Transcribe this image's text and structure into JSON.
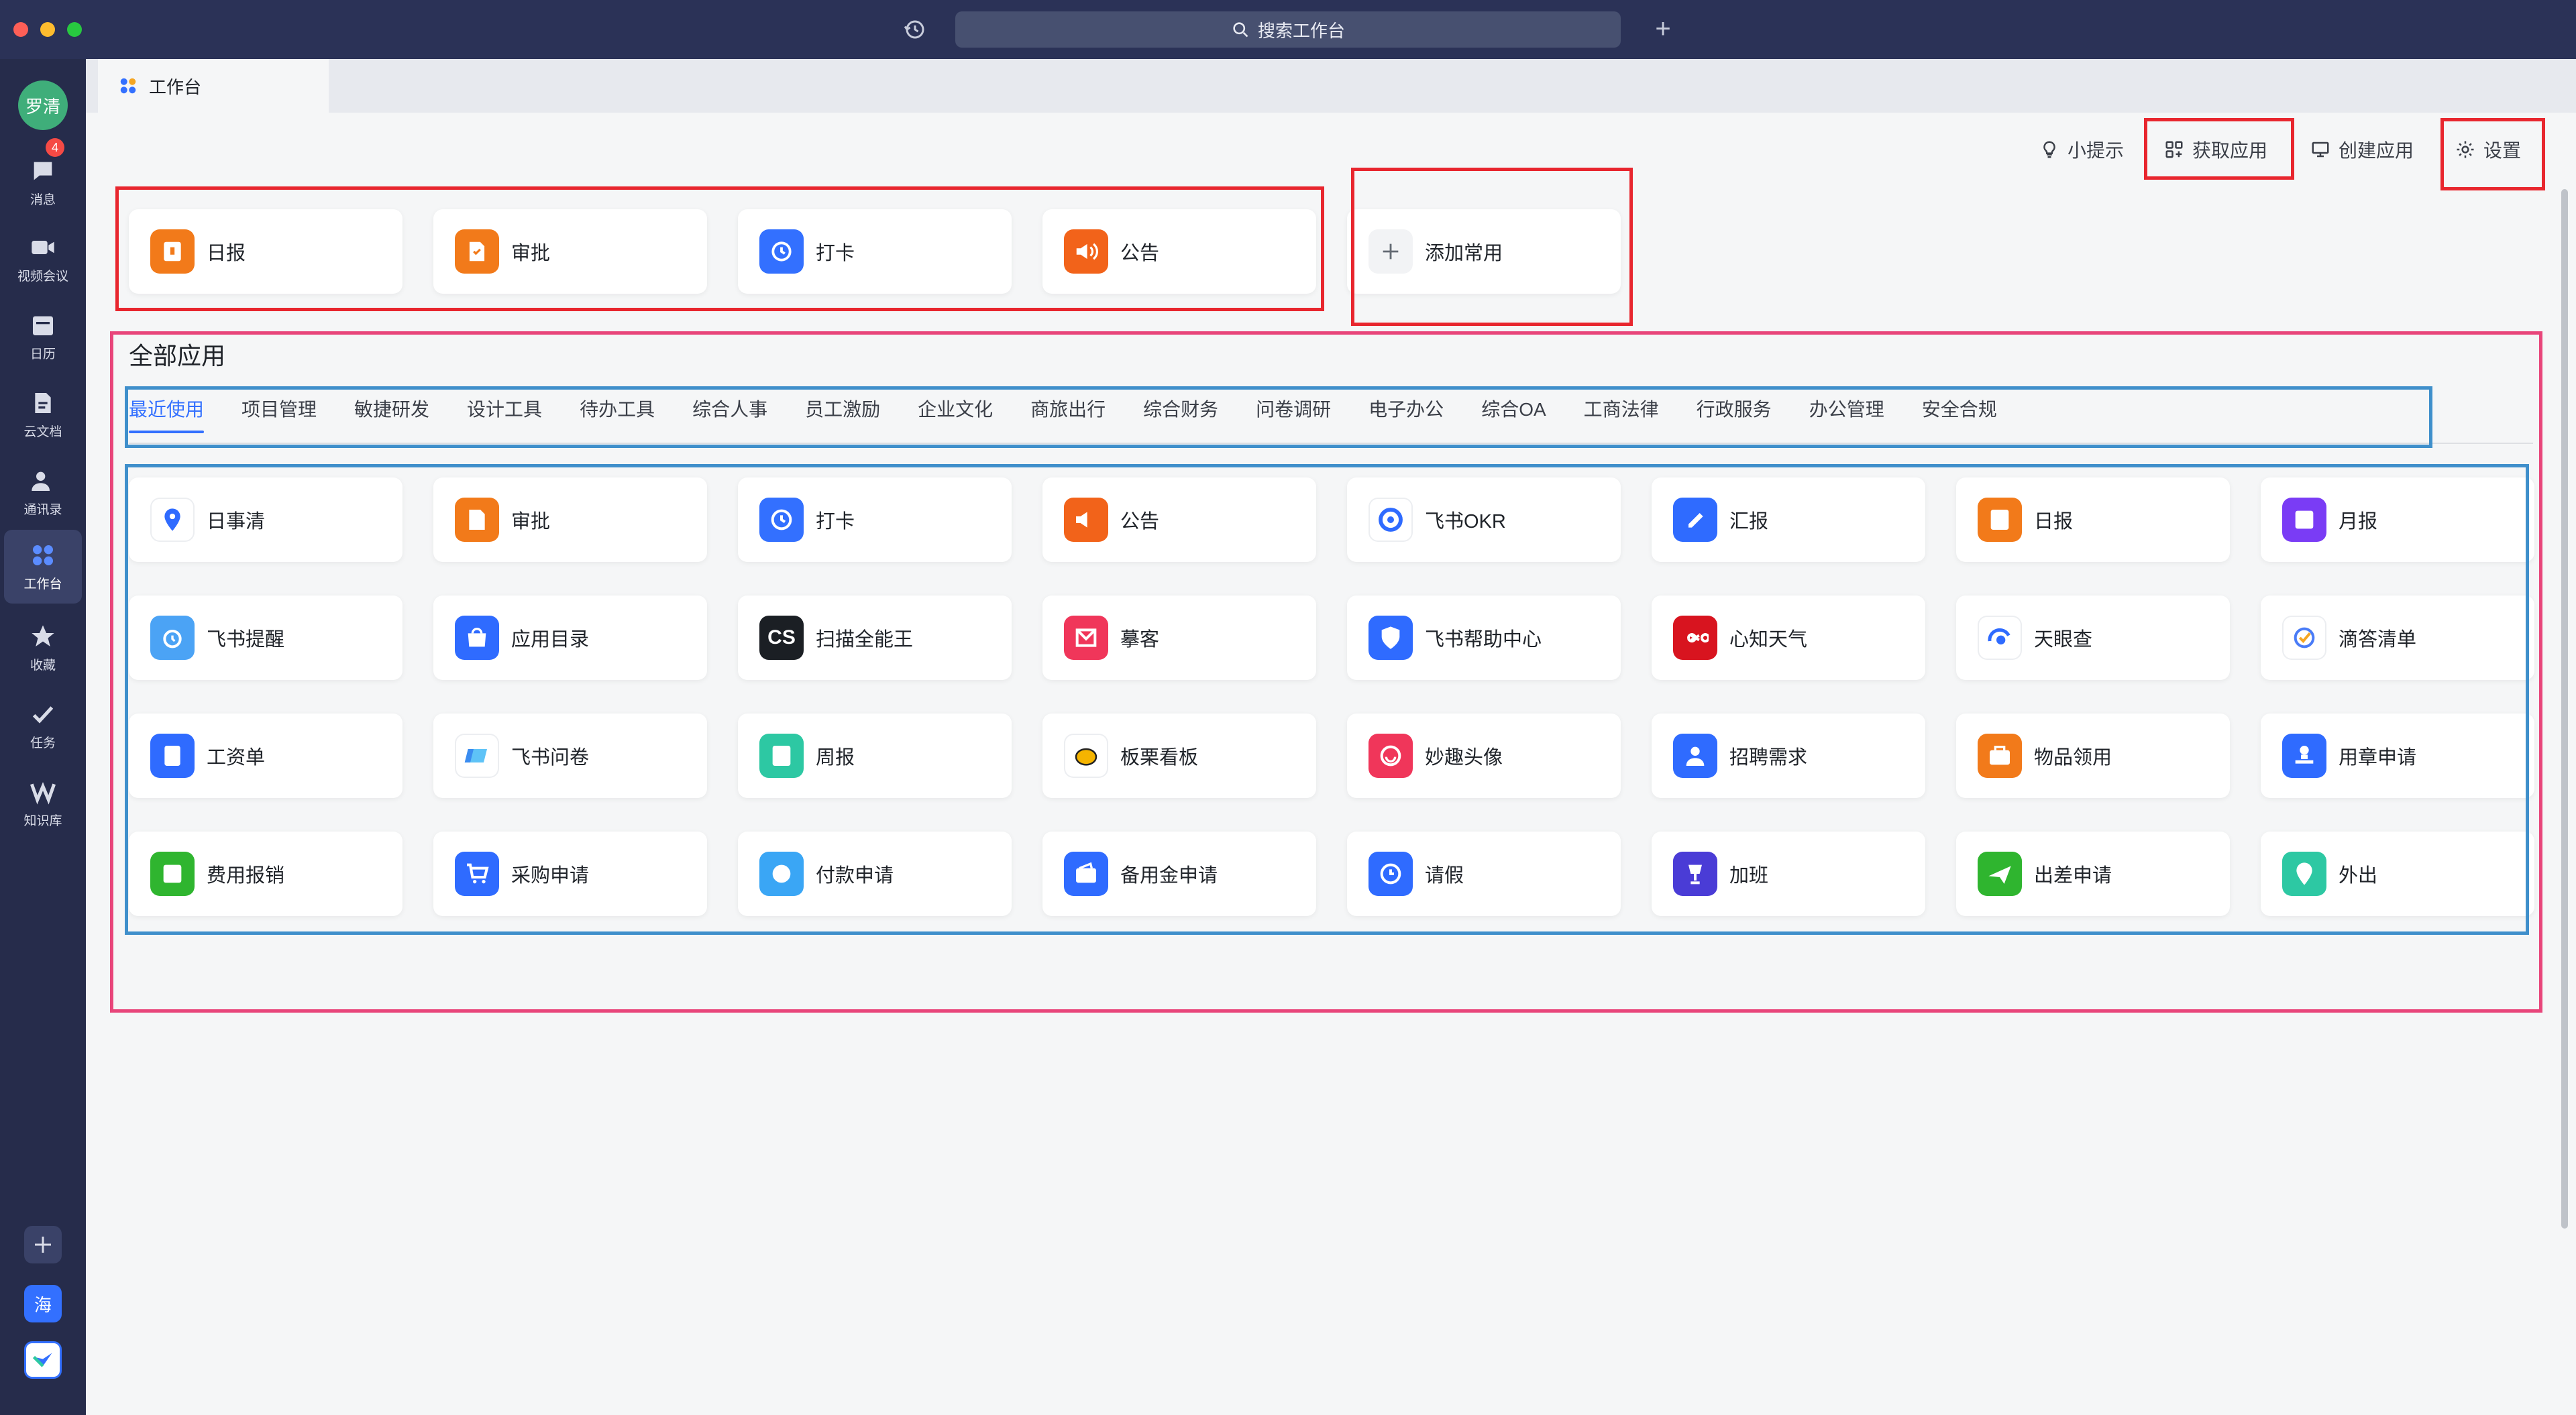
{
  "titlebar": {
    "search_placeholder": "搜索工作台",
    "colors": {
      "bar": "#2b3257",
      "search": "#475070"
    }
  },
  "sidebar": {
    "avatar_text": "罗清",
    "badge_count": "4",
    "items": [
      {
        "label": "消息",
        "icon": "message-icon"
      },
      {
        "label": "视频会议",
        "icon": "video-icon"
      },
      {
        "label": "日历",
        "icon": "calendar-icon"
      },
      {
        "label": "云文档",
        "icon": "doc-icon"
      },
      {
        "label": "通讯录",
        "icon": "contacts-icon"
      },
      {
        "label": "工作台",
        "icon": "workplace-icon",
        "active": true
      },
      {
        "label": "收藏",
        "icon": "star-icon"
      },
      {
        "label": "任务",
        "icon": "task-icon"
      },
      {
        "label": "知识库",
        "icon": "wiki-icon"
      }
    ],
    "bottom_app_label": "海"
  },
  "tabbar": {
    "tab_label": "工作台"
  },
  "actions": {
    "tips": "小提示",
    "get_apps": "获取应用",
    "create_app": "创建应用",
    "settings": "设置"
  },
  "favorites": {
    "apps": [
      {
        "label": "日报",
        "icon": "daily-report-icon",
        "color": "#f27a1a"
      },
      {
        "label": "审批",
        "icon": "approval-icon",
        "color": "#f27a1a"
      },
      {
        "label": "打卡",
        "icon": "clock-in-icon",
        "color": "#3370ff"
      },
      {
        "label": "公告",
        "icon": "announcement-icon",
        "color": "#f2631a"
      }
    ],
    "add_label": "添加常用"
  },
  "all_apps": {
    "title": "全部应用",
    "categories": [
      "最近使用",
      "项目管理",
      "敏捷研发",
      "设计工具",
      "待办工具",
      "综合人事",
      "员工激励",
      "企业文化",
      "商旅出行",
      "综合财务",
      "问卷调研",
      "电子办公",
      "综合OA",
      "工商法律",
      "行政服务",
      "办公管理",
      "安全合规"
    ],
    "active_category": "最近使用",
    "rows": [
      [
        {
          "label": "日事清",
          "icon": "location-pin-icon",
          "color": "#ffffff",
          "fg": "#2f6bff"
        },
        {
          "label": "审批",
          "icon": "approval-icon",
          "color": "#f27a1a"
        },
        {
          "label": "打卡",
          "icon": "clock-in-icon",
          "color": "#3370ff"
        },
        {
          "label": "公告",
          "icon": "announcement-icon",
          "color": "#f2631a"
        },
        {
          "label": "飞书OKR",
          "icon": "okr-icon",
          "color": "#ffffff",
          "fg": "#2f6bff"
        },
        {
          "label": "汇报",
          "icon": "report-pen-icon",
          "color": "#2f6bff"
        },
        {
          "label": "日报",
          "icon": "daily-report-icon",
          "color": "#f27a1a"
        },
        {
          "label": "月报",
          "icon": "monthly-report-icon",
          "color": "#7a3cf5"
        }
      ],
      [
        {
          "label": "飞书提醒",
          "icon": "alarm-clock-icon",
          "color": "#4ba3f5"
        },
        {
          "label": "应用目录",
          "icon": "bag-icon",
          "color": "#2f6bff"
        },
        {
          "label": "扫描全能王",
          "icon": "cs-icon",
          "color": "#1b1f24"
        },
        {
          "label": "摹客",
          "icon": "mockplus-icon",
          "color": "#f0365a"
        },
        {
          "label": "飞书帮助中心",
          "icon": "help-shield-icon",
          "color": "#2f6bff"
        },
        {
          "label": "心知天气",
          "icon": "infinity-icon",
          "color": "#d8141f"
        },
        {
          "label": "天眼查",
          "icon": "eye-check-icon",
          "color": "#ffffff",
          "fg": "#2f6bff"
        },
        {
          "label": "滴答清单",
          "icon": "check-circle-icon",
          "color": "#ffffff",
          "fg": "#4a7cf7"
        }
      ],
      [
        {
          "label": "工资单",
          "icon": "payslip-icon",
          "color": "#2f6bff"
        },
        {
          "label": "飞书问卷",
          "icon": "survey-icon",
          "color": "#ffffff",
          "fg": "#3a8cf0"
        },
        {
          "label": "周报",
          "icon": "weekly-report-icon",
          "color": "#2dc8a3"
        },
        {
          "label": "板栗看板",
          "icon": "chestnut-icon",
          "color": "#ffffff",
          "fg": "#f5b400"
        },
        {
          "label": "妙趣头像",
          "icon": "smile-icon",
          "color": "#f0365a"
        },
        {
          "label": "招聘需求",
          "icon": "recruit-icon",
          "color": "#2f6bff"
        },
        {
          "label": "物品领用",
          "icon": "box-icon",
          "color": "#f27a1a"
        },
        {
          "label": "用章申请",
          "icon": "stamp-icon",
          "color": "#2f6bff"
        }
      ],
      [
        {
          "label": "费用报销",
          "icon": "expense-icon",
          "color": "#2fb52f"
        },
        {
          "label": "采购申请",
          "icon": "cart-icon",
          "color": "#2f6bff"
        },
        {
          "label": "付款申请",
          "icon": "payment-icon",
          "color": "#3aa6f5"
        },
        {
          "label": "备用金申请",
          "icon": "wallet-icon",
          "color": "#2f6bff"
        },
        {
          "label": "请假",
          "icon": "leave-clock-icon",
          "color": "#2f6bff"
        },
        {
          "label": "加班",
          "icon": "lamp-icon",
          "color": "#4a3cd6"
        },
        {
          "label": "出差申请",
          "icon": "plane-icon",
          "color": "#2fb52f"
        },
        {
          "label": "外出",
          "icon": "outing-pin-icon",
          "color": "#2dc8a3"
        }
      ]
    ]
  },
  "colors": {
    "accent": "#3370ff",
    "annotation_red": "#e8262e",
    "annotation_pink": "#e8457a",
    "annotation_blue": "#3f8fcb"
  }
}
